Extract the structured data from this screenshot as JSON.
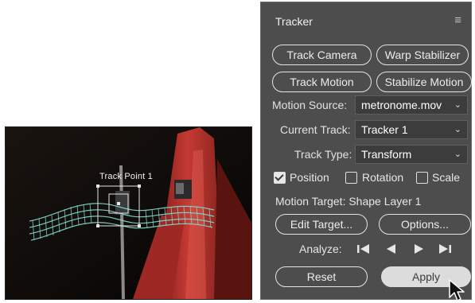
{
  "preview": {
    "track_point_label": "Track Point 1"
  },
  "panel": {
    "title": "Tracker",
    "menu_icon": "hamburger-menu-icon",
    "buttons": {
      "track_camera": "Track Camera",
      "warp_stabilizer": "Warp Stabilizer",
      "track_motion": "Track Motion",
      "stabilize_motion": "Stabilize Motion",
      "edit_target": "Edit Target...",
      "options": "Options...",
      "reset": "Reset",
      "apply": "Apply"
    },
    "motion_source": {
      "label": "Motion Source:",
      "value": "metronome.mov"
    },
    "current_track": {
      "label": "Current Track:",
      "value": "Tracker 1"
    },
    "track_type": {
      "label": "Track Type:",
      "value": "Transform"
    },
    "checkboxes": {
      "position": {
        "label": "Position",
        "checked": true
      },
      "rotation": {
        "label": "Rotation",
        "checked": false
      },
      "scale": {
        "label": "Scale",
        "checked": false
      }
    },
    "motion_target": "Motion Target: Shape Layer 1",
    "analyze": {
      "label": "Analyze:",
      "controls": [
        "analyze-backward-one-frame-icon",
        "analyze-backward-icon",
        "analyze-forward-icon",
        "analyze-forward-one-frame-icon"
      ]
    }
  },
  "colors": {
    "panel_bg": "#4d4d4d",
    "trail": "#7fd3c8",
    "metronome": "#b8312b"
  }
}
